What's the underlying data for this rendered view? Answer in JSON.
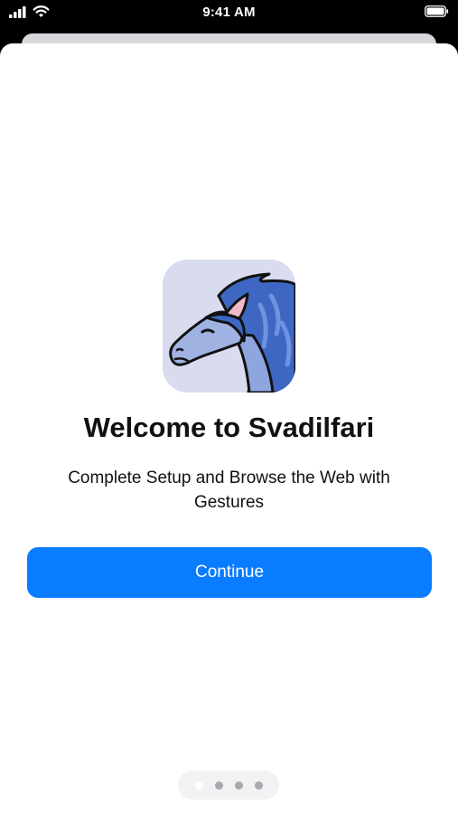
{
  "status_bar": {
    "time": "9:41 AM",
    "icons": [
      "signal-icon",
      "wifi-icon",
      "battery-icon"
    ]
  },
  "onboarding": {
    "title": "Welcome to Svadilfari",
    "subtitle": "Complete Setup and Browse the Web with Gestures",
    "continue_label": "Continue",
    "app_icon": "horse-app-icon"
  },
  "page_indicator": {
    "total_pages": 4,
    "current_page": 1
  },
  "colors": {
    "accent": "#0a7cff",
    "icon_background": "#d9dcef",
    "horse_blue": "#3e67c4"
  }
}
